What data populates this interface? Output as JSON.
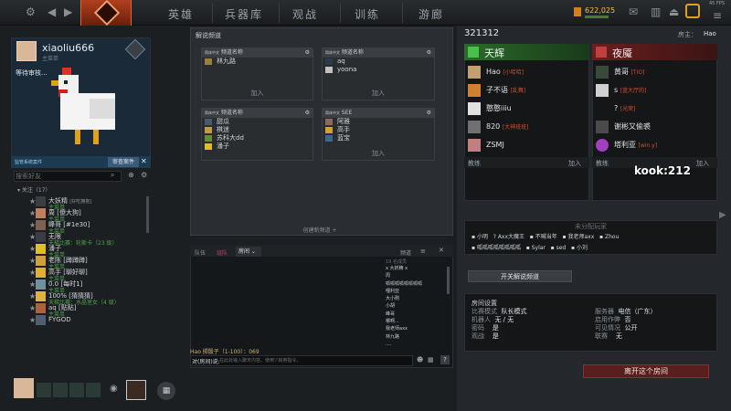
{
  "topbar": {
    "nav": [
      "英雄",
      "兵器库",
      "观战",
      "训练",
      "游廊"
    ],
    "gold": "622,025",
    "fps": "45 FPS"
  },
  "profile": {
    "name": "xiaoliu666",
    "status": "主菜单",
    "waiting": "等待审核...",
    "case_button": "审查案件",
    "case_label": "监管系统案件",
    "search_placeholder": "搜索好友"
  },
  "friends": {
    "header": "关注（17）",
    "items": [
      {
        "name": "大妖精",
        "sub": "主菜单",
        "extra": "[好吃拥抱]"
      },
      {
        "name": "周 [傻大狗]",
        "sub": "主菜单"
      },
      {
        "name": "峰哥 [#1e30]",
        "sub": "主菜单"
      },
      {
        "name": "无限",
        "sub": "天梯比赛：轮斯卡（23 级）"
      },
      {
        "name": "潘子",
        "sub": "主菜单"
      },
      {
        "name": "老陈 [蹲蹲蹲]",
        "sub": "主菜单"
      },
      {
        "name": "高手 [聊好聊]",
        "sub": "主菜单"
      },
      {
        "name": "0.0 [每时1]",
        "sub": "主菜单"
      },
      {
        "name": "100% [猜猜猜]",
        "sub": "天梯比赛：水晶室女（4 级）"
      },
      {
        "name": "aq [贴贴]",
        "sub": "主菜单"
      },
      {
        "name": "FYGOD",
        "sub": ""
      }
    ]
  },
  "commentary": {
    "title": "解说频道",
    "channels": [
      {
        "lang": "简体中文",
        "label": "频道名称",
        "members": [
          "林九路"
        ],
        "join": "加入"
      },
      {
        "lang": "简体中文",
        "label": "频道名称",
        "members": [
          "aq",
          "yoona"
        ],
        "join": "加入"
      },
      {
        "lang": "简体中文",
        "label": "频道名称",
        "members": [
          "甜瓜",
          "棋迷",
          "苏科大dd",
          "潘子"
        ],
        "join": "加入"
      },
      {
        "lang": "简体中文",
        "label": "SEE",
        "members": [
          "阿雅",
          "高手",
          "蓝宝"
        ],
        "join": "加入"
      }
    ],
    "create": "创建新频道"
  },
  "chat": {
    "tabs": [
      "队伍",
      "组队",
      "房间"
    ],
    "channel_label": "频道",
    "lines": [
      "Hao 掷骰子（1-100）：069"
    ],
    "input_label": "对(房间)说:",
    "input_placeholder": "在此处输入聊天内容。使用'/'启用指令。",
    "members_header": "19 名成员",
    "members": [
      "x 大妖精 x",
      "周",
      "呱呱呱呱呱呱呱呱",
      "哩利亚",
      "大小刚",
      "小胡",
      "峰哥",
      "哪啊...",
      "我老师axx",
      "林九路",
      "...."
    ]
  },
  "lobby": {
    "id": "321312",
    "host_label": "房主：",
    "host": "Hao",
    "radiant": "天辉",
    "dire": "夜魇",
    "radiant_players": [
      {
        "name": "Hao",
        "tag": "[小哈哈]"
      },
      {
        "name": "子不语",
        "tag": "[乱舞]"
      },
      {
        "name": "憨憨iiiu",
        "tag": ""
      },
      {
        "name": "820",
        "tag": "[大神班班]"
      },
      {
        "name": "ZSMJ",
        "tag": ""
      }
    ],
    "dire_players": [
      {
        "name": "黄哥",
        "tag": "[TIO]"
      },
      {
        "name": "s",
        "tag": "[蓝大厅的]"
      },
      {
        "name": "?",
        "tag": "[光荣]"
      },
      {
        "name": "谢彬又偷裘",
        "tag": ""
      },
      {
        "name": "塔利亚",
        "tag": "[win.y]"
      }
    ],
    "coach": "教练",
    "join": "加入",
    "unassigned_title": "未分配玩家",
    "unassigned": [
      "小明",
      "Axx大魔王",
      "不喊当年",
      "我老师axx",
      "Zhou",
      "呱呱呱呱呱呱呱呱",
      "Sylar",
      "sed",
      "小刘"
    ],
    "open_commentary": "开关解说频道",
    "settings_title": "房间设置",
    "settings_left": [
      [
        "比赛模式",
        "队长模式"
      ],
      [
        "机器人",
        "无 / 无"
      ],
      [
        "密码",
        "是"
      ],
      [
        "观战",
        "是"
      ]
    ],
    "settings_right": [
      [
        "服务器",
        "电信（广东）"
      ],
      [
        "启用作弊",
        "否"
      ],
      [
        "可见情况",
        "公开"
      ],
      [
        "联赛",
        "无"
      ]
    ],
    "leave": "离开这个房间"
  },
  "watermark": "kook:212"
}
